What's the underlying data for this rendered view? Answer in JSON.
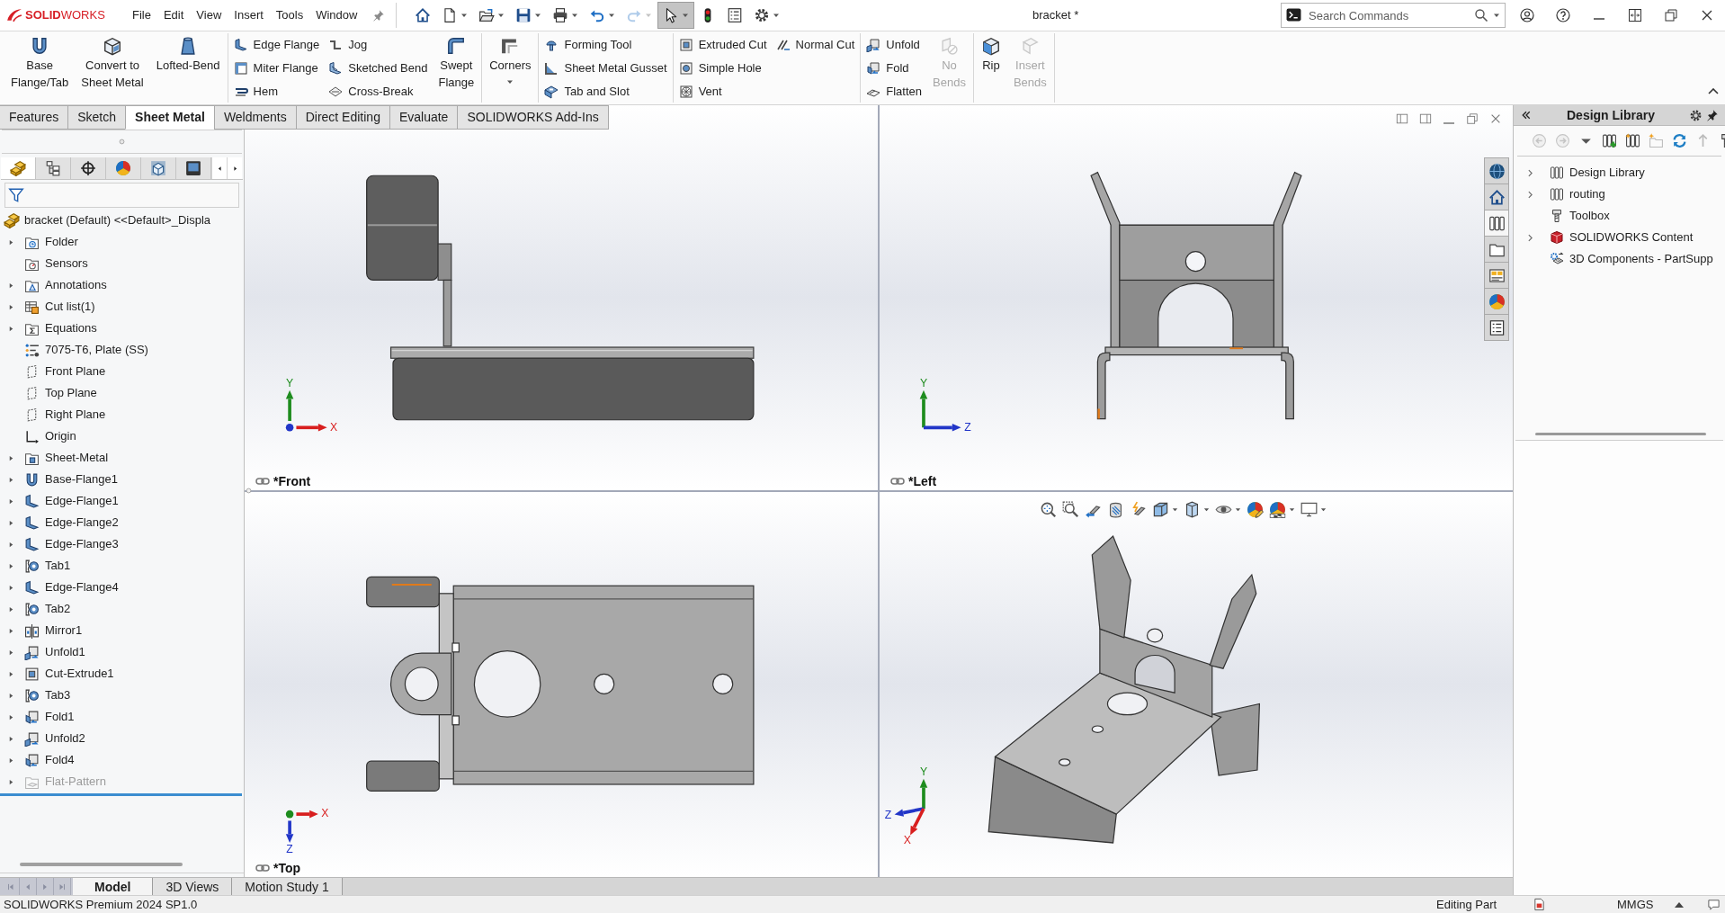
{
  "app": {
    "logo": "**SOLID**WORKS",
    "menus": [
      "File",
      "Edit",
      "View",
      "Insert",
      "Tools",
      "Window"
    ],
    "quick_access": [
      {
        "pressed": false,
        "disabled": false
      },
      {
        "pressed": false,
        "disabled": false
      },
      {
        "pressed": false,
        "disabled": false
      },
      {
        "pressed": false,
        "disabled": false
      },
      {
        "pressed": false,
        "disabled": false
      },
      {
        "pressed": false,
        "disabled": false
      },
      {
        "pressed": false,
        "disabled": true
      },
      {
        "pressed": true,
        "disabled": false
      },
      {
        "pressed": false,
        "disabled": false
      },
      {
        "pressed": false,
        "disabled": false
      },
      {
        "pressed": false,
        "disabled": false
      }
    ],
    "title": "bracket *",
    "search": {
      "placeholder": "Search Commands"
    }
  },
  "ribbon_groups": [
    {
      "items": [
        {
          "kind": "large",
          "lines": [
            "Base",
            "Flange/Tab"
          ],
          "disabled": false
        },
        {
          "kind": "large",
          "lines": [
            "Convert to",
            "Sheet Metal"
          ],
          "disabled": false
        },
        {
          "kind": "large",
          "lines": [
            "Lofted-Bend"
          ],
          "disabled": false
        }
      ]
    },
    {
      "items": [
        {
          "kind": "stack",
          "buttons": [
            {
              "label": "Edge Flange",
              "disabled": false
            },
            {
              "label": "Miter Flange",
              "disabled": false
            },
            {
              "label": "Hem",
              "disabled": false
            }
          ]
        },
        {
          "kind": "stack",
          "buttons": [
            {
              "label": "Jog",
              "disabled": false
            },
            {
              "label": "Sketched Bend",
              "disabled": false
            },
            {
              "label": "Cross-Break",
              "disabled": false
            }
          ]
        },
        {
          "kind": "large",
          "lines": [
            "Swept",
            "Flange"
          ],
          "disabled": false
        }
      ]
    },
    {
      "items": [
        {
          "kind": "dropdown",
          "lines": [
            "Corners"
          ],
          "disabled": false
        }
      ]
    },
    {
      "items": [
        {
          "kind": "stack",
          "buttons": [
            {
              "label": "Forming Tool",
              "disabled": false
            },
            {
              "label": "Sheet Metal Gusset",
              "disabled": false
            },
            {
              "label": "Tab and Slot",
              "disabled": false
            }
          ]
        }
      ]
    },
    {
      "items": [
        {
          "kind": "stack",
          "buttons": [
            {
              "label": "Extruded Cut",
              "disabled": false
            },
            {
              "label": "Simple Hole",
              "disabled": false
            },
            {
              "label": "Vent",
              "disabled": false
            }
          ]
        },
        {
          "kind": "stack",
          "buttons": [
            {
              "label": "Normal Cut",
              "disabled": false
            }
          ]
        }
      ]
    },
    {
      "items": [
        {
          "kind": "stack",
          "buttons": [
            {
              "label": "Unfold",
              "disabled": false
            },
            {
              "label": "Fold",
              "disabled": false
            },
            {
              "label": "Flatten",
              "disabled": false
            }
          ]
        },
        {
          "kind": "large",
          "lines": [
            "No",
            "Bends"
          ],
          "disabled": true
        }
      ]
    },
    {
      "items": [
        {
          "kind": "large",
          "lines": [
            "Rip"
          ],
          "disabled": false
        },
        {
          "kind": "large",
          "lines": [
            "Insert",
            "Bends"
          ],
          "disabled": true
        }
      ]
    }
  ],
  "command_tabs": [
    {
      "label": "Features",
      "selected": false
    },
    {
      "label": "Sketch",
      "selected": false
    },
    {
      "label": "Sheet Metal",
      "selected": true
    },
    {
      "label": "Weldments",
      "selected": false
    },
    {
      "label": "Direct Editing",
      "selected": false
    },
    {
      "label": "Evaluate",
      "selected": false
    },
    {
      "label": "SOLIDWORKS Add-Ins",
      "selected": false
    }
  ],
  "feature_manager": {
    "panel_tabs": [
      {
        "selected": true
      },
      {
        "selected": false
      },
      {
        "selected": false
      },
      {
        "selected": false
      },
      {
        "selected": false
      },
      {
        "selected": false
      }
    ],
    "root": "bracket (Default) <<Default>_Displa",
    "items": [
      {
        "label": "Folder",
        "expanded": false,
        "suppressed": false
      },
      {
        "label": "Sensors",
        "suppressed": false
      },
      {
        "label": "Annotations",
        "expanded": false,
        "suppressed": false
      },
      {
        "label": "Cut list(1)",
        "expanded": false,
        "suppressed": false
      },
      {
        "label": "Equations",
        "expanded": false,
        "suppressed": false
      },
      {
        "label": "7075-T6, Plate (SS)",
        "suppressed": false
      },
      {
        "label": "Front Plane",
        "suppressed": false
      },
      {
        "label": "Top Plane",
        "suppressed": false
      },
      {
        "label": "Right Plane",
        "suppressed": false
      },
      {
        "label": "Origin",
        "suppressed": false
      },
      {
        "label": "Sheet-Metal",
        "expanded": false,
        "suppressed": false
      },
      {
        "label": "Base-Flange1",
        "expanded": false,
        "suppressed": false
      },
      {
        "label": "Edge-Flange1",
        "expanded": false,
        "suppressed": false
      },
      {
        "label": "Edge-Flange2",
        "expanded": false,
        "suppressed": false
      },
      {
        "label": "Edge-Flange3",
        "expanded": false,
        "suppressed": false
      },
      {
        "label": "Tab1",
        "expanded": false,
        "suppressed": false
      },
      {
        "label": "Edge-Flange4",
        "expanded": false,
        "suppressed": false
      },
      {
        "label": "Tab2",
        "expanded": false,
        "suppressed": false
      },
      {
        "label": "Mirror1",
        "expanded": false,
        "suppressed": false
      },
      {
        "label": "Unfold1",
        "expanded": false,
        "suppressed": false
      },
      {
        "label": "Cut-Extrude1",
        "expanded": false,
        "suppressed": false
      },
      {
        "label": "Tab3",
        "expanded": false,
        "suppressed": false
      },
      {
        "label": "Fold1",
        "expanded": false,
        "suppressed": false
      },
      {
        "label": "Unfold2",
        "expanded": false,
        "suppressed": false
      },
      {
        "label": "Fold4",
        "expanded": false,
        "suppressed": false
      },
      {
        "label": "Flat-Pattern",
        "expanded": false,
        "suppressed": true
      }
    ]
  },
  "viewport": {
    "views": [
      {
        "kind": "front",
        "label": "*Front",
        "axes": [
          {
            "label": "Y",
            "kind": "up",
            "color": "#1e8c1e"
          },
          {
            "label": "X",
            "kind": "right",
            "color": "#d81e1e"
          },
          {
            "kind": "dot",
            "color": "#2236c8"
          }
        ]
      },
      {
        "kind": "left",
        "label": "*Left",
        "axes": [
          {
            "label": "Y",
            "kind": "up",
            "color": "#1e8c1e"
          },
          {
            "label": "Z",
            "kind": "right",
            "color": "#2236c8"
          }
        ]
      },
      {
        "kind": "top",
        "label": "*Top",
        "axes": [
          {
            "label": "X",
            "kind": "right",
            "color": "#d81e1e"
          },
          {
            "label": "Z",
            "kind": "down",
            "color": "#2236c8"
          },
          {
            "kind": "dot",
            "color": "#1e8c1e"
          }
        ]
      },
      {
        "kind": "isometric",
        "axes": [
          {
            "label": "Y",
            "kind": "up",
            "color": "#1e8c1e"
          },
          {
            "label": "Z",
            "kind": "left",
            "color": "#2236c8"
          },
          {
            "label": "X",
            "kind": "downleft",
            "color": "#d81e1e"
          }
        ]
      }
    ]
  },
  "model_tabs": [
    {
      "label": "Model",
      "selected": true
    },
    {
      "label": "3D Views",
      "selected": false
    },
    {
      "label": "Motion Study 1",
      "selected": false
    }
  ],
  "task_pane": {
    "tabs": [
      {
        "selected": false
      },
      {
        "selected": false
      },
      {
        "selected": true
      },
      {
        "selected": false
      },
      {
        "selected": false
      },
      {
        "selected": false
      },
      {
        "selected": false
      }
    ],
    "title": "Design Library",
    "items": [
      {
        "label": "Design Library",
        "expanded": false
      },
      {
        "label": "routing",
        "expanded": false
      },
      {
        "label": "Toolbox"
      },
      {
        "label": "SOLIDWORKS Content",
        "expanded": false
      },
      {
        "label": "3D Components - PartSupp"
      }
    ]
  },
  "status_bar": {
    "product": "SOLIDWORKS Premium 2024 SP1.0",
    "mode": "Editing Part",
    "units": "MMGS"
  }
}
